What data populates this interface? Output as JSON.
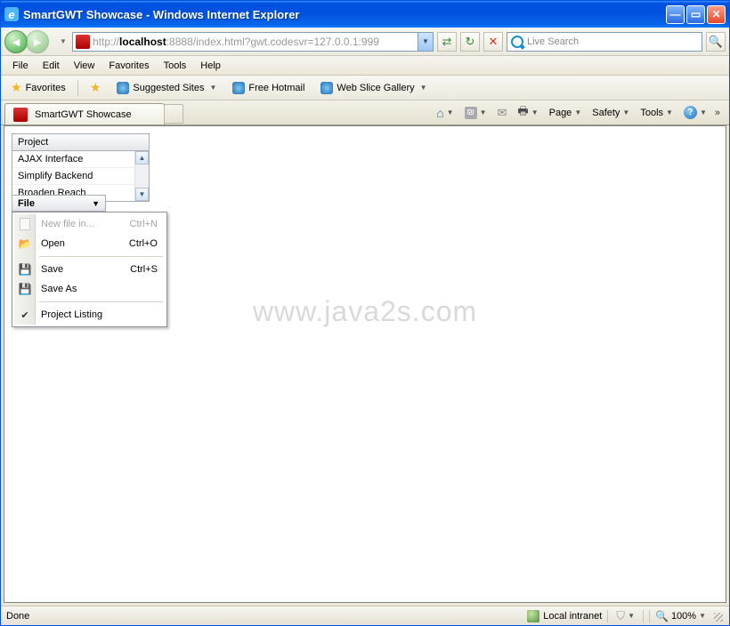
{
  "window": {
    "title": "SmartGWT Showcase - Windows Internet Explorer"
  },
  "addressbar": {
    "prefix": "http://",
    "host": "localhost",
    "rest": ":8888/index.html?gwt.codesvr=127.0.0.1:999"
  },
  "nav_icons": {
    "refresh": "↻",
    "stop": "✕"
  },
  "search": {
    "placeholder": "Live Search"
  },
  "menubar": {
    "items": [
      "File",
      "Edit",
      "View",
      "Favorites",
      "Tools",
      "Help"
    ]
  },
  "favbar": {
    "favorites": "Favorites",
    "suggested": "Suggested Sites",
    "hotmail": "Free Hotmail",
    "webslice": "Web Slice Gallery"
  },
  "tab": {
    "title": "SmartGWT Showcase"
  },
  "commands": {
    "page": "Page",
    "safety": "Safety",
    "tools": "Tools"
  },
  "project_list": {
    "header": "Project",
    "rows": [
      "AJAX Interface",
      "Simplify Backend",
      "Broaden Reach"
    ]
  },
  "file_menu": {
    "label": "File",
    "items": {
      "new": {
        "label": "New file in...",
        "shortcut": "Ctrl+N"
      },
      "open": {
        "label": "Open",
        "shortcut": "Ctrl+O"
      },
      "save": {
        "label": "Save",
        "shortcut": "Ctrl+S"
      },
      "saveas": {
        "label": "Save As"
      },
      "listing": {
        "label": "Project Listing"
      }
    }
  },
  "watermark": "www.java2s.com",
  "status": {
    "left": "Done",
    "zone": "Local intranet",
    "zoom": "100%"
  }
}
